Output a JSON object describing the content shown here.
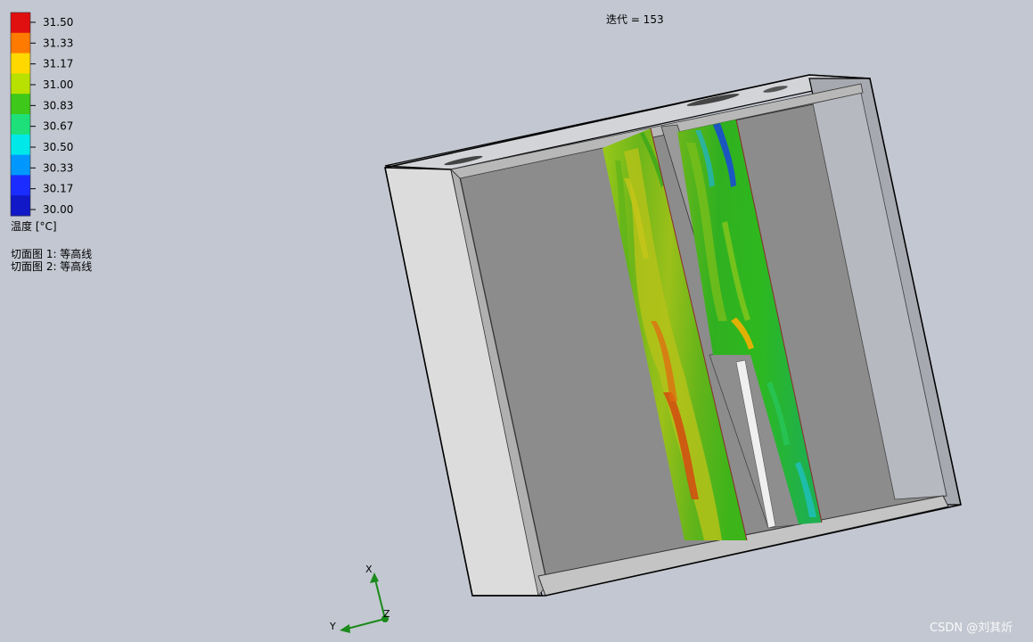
{
  "iteration": {
    "text": "迭代 = 153"
  },
  "legend": {
    "values": [
      "31.50",
      "31.33",
      "31.17",
      "31.00",
      "30.83",
      "30.67",
      "30.50",
      "30.33",
      "30.17",
      "30.00"
    ],
    "colors": [
      "#e01010",
      "#ff7a00",
      "#ffd800",
      "#b8e000",
      "#3ec81a",
      "#1ee07a",
      "#00e8e8",
      "#0098ff",
      "#1a2cff",
      "#1018c8"
    ],
    "title": "温度 [°C]"
  },
  "cut_plots": {
    "plot1": "切面图 1: 等高线",
    "plot2": "切面图 2: 等高线"
  },
  "triad": {
    "x_label": "X",
    "y_label": "Y",
    "z_label": "Z"
  },
  "watermark": "CSDN @刘其炘"
}
